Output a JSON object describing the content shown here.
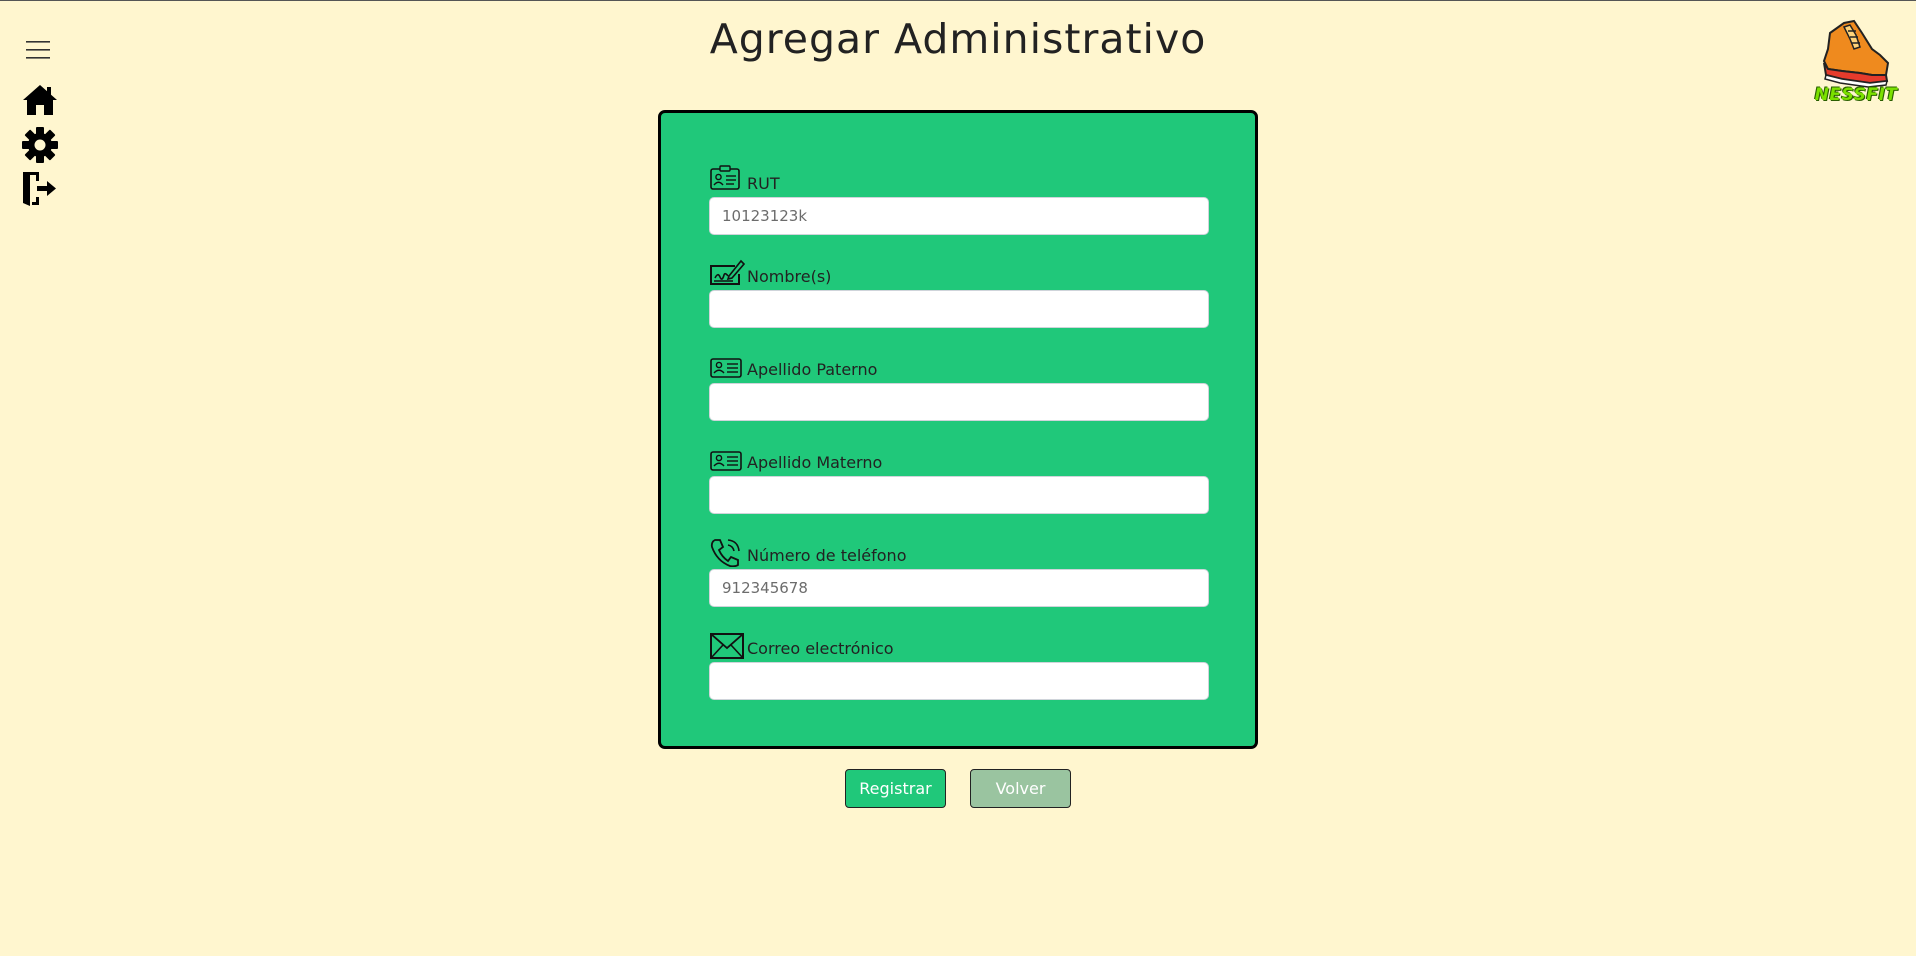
{
  "header": {
    "title": "Agregar Administrativo"
  },
  "sidebar": {
    "items": [
      {
        "icon": "menu-icon"
      },
      {
        "icon": "home-icon"
      },
      {
        "icon": "gear-icon"
      },
      {
        "icon": "logout-icon"
      }
    ]
  },
  "logo": {
    "text": "NESSFIT",
    "icon": "sneaker-logo"
  },
  "form": {
    "fields": [
      {
        "label": "RUT",
        "icon": "id-badge-icon",
        "value": "",
        "placeholder": "10123123k"
      },
      {
        "label": "Nombre(s)",
        "icon": "signature-icon",
        "value": "",
        "placeholder": ""
      },
      {
        "label": "Apellido Paterno",
        "icon": "id-card-icon",
        "value": "",
        "placeholder": ""
      },
      {
        "label": "Apellido Materno",
        "icon": "id-card-icon",
        "value": "",
        "placeholder": ""
      },
      {
        "label": "Número de teléfono",
        "icon": "phone-icon",
        "value": "",
        "placeholder": "912345678"
      },
      {
        "label": "Correo electrónico",
        "icon": "envelope-icon",
        "value": "",
        "placeholder": ""
      }
    ]
  },
  "actions": {
    "submit_label": "Registrar",
    "back_label": "Volver"
  },
  "colors": {
    "background": "#fff6cf",
    "form_green": "#20c87a",
    "back_button": "#9ac4a0",
    "logo_green": "#7be000"
  }
}
